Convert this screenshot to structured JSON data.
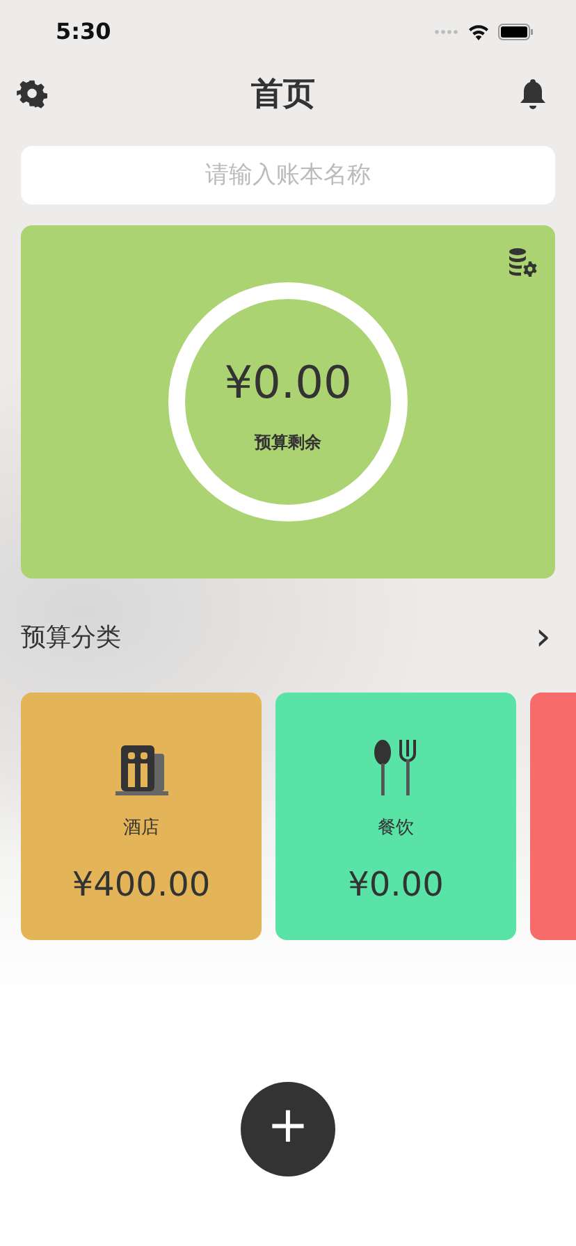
{
  "status_bar": {
    "time": "5:30"
  },
  "nav": {
    "title": "首页"
  },
  "search": {
    "placeholder": "请输入账本名称"
  },
  "budget": {
    "amount": "¥0.00",
    "label": "预算剩余"
  },
  "section": {
    "title": "预算分类",
    "more": "›"
  },
  "categories": [
    {
      "kind": "hotel",
      "name": "酒店",
      "amount": "¥400.00",
      "color": "#e3b558"
    },
    {
      "kind": "dining",
      "name": "餐饮",
      "amount": "¥0.00",
      "color": "#59e3a6"
    },
    {
      "kind": "clipped",
      "color": "#f76b6b"
    }
  ],
  "fab": {
    "label": "+"
  }
}
